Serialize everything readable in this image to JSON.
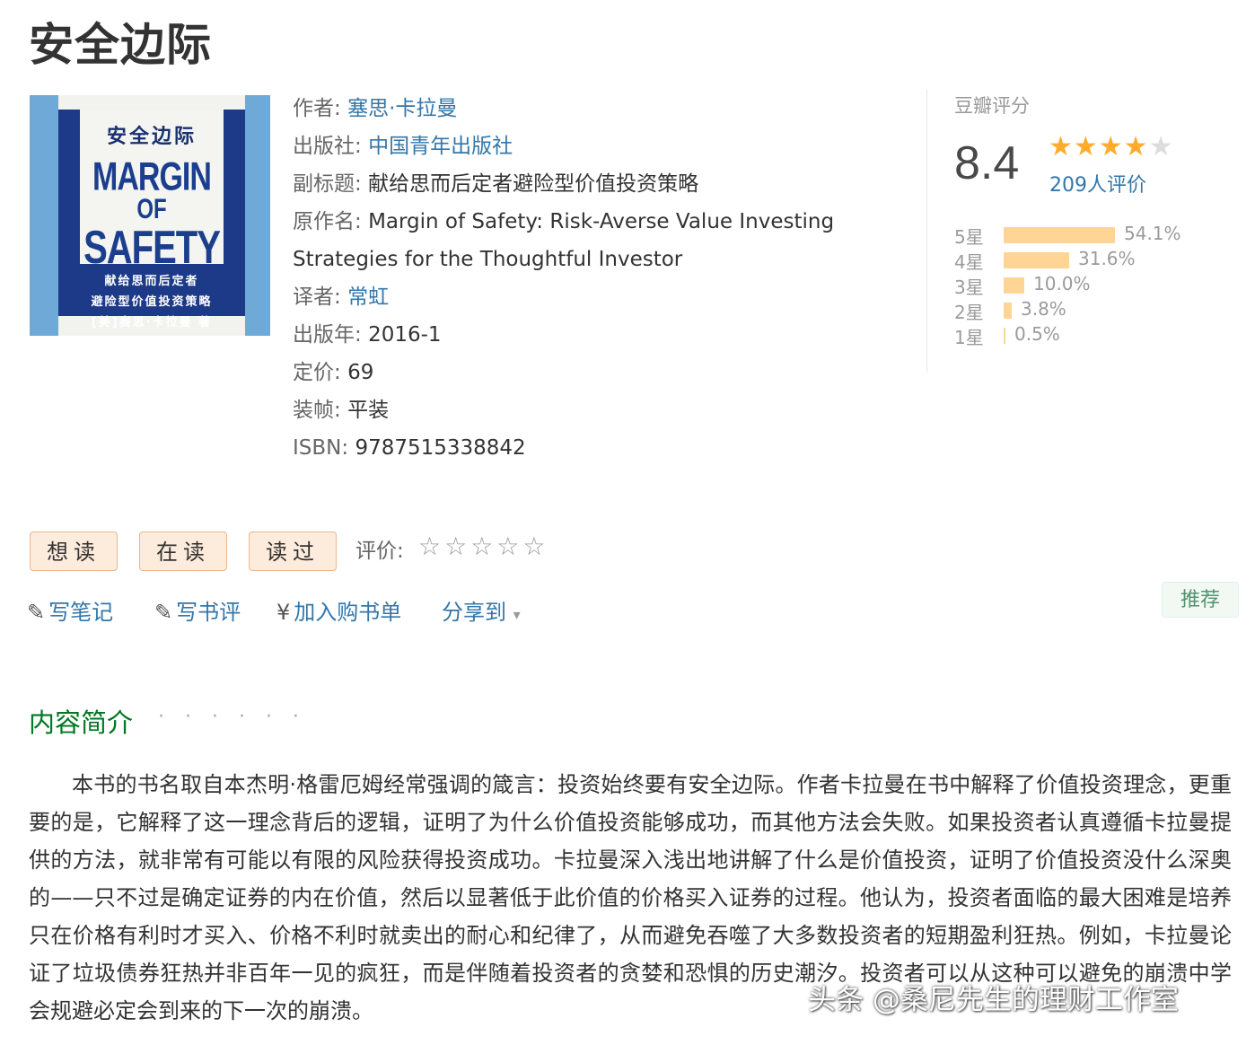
{
  "page_title": "安全边际",
  "cover": {
    "cn_title": "安全边际",
    "en_line1": "MARGIN",
    "en_line2": "OF",
    "en_line3": "SAFETY",
    "sub1": "献给思而后定者",
    "sub2": "避险型价值投资策略",
    "sub3": "[美]赛思·卡拉曼 著"
  },
  "info": {
    "author_label": "作者:",
    "author": "塞思·卡拉曼",
    "publisher_label": "出版社:",
    "publisher": "中国青年出版社",
    "subtitle_label": "副标题:",
    "subtitle": "献给思而后定者避险型价值投资策略",
    "original_title_label": "原作名:",
    "original_title_line1": "Margin of Safety: Risk-Averse Value Investing",
    "original_title_line2": "Strategies for the Thoughtful Investor",
    "translator_label": "译者:",
    "translator": "常虹",
    "pub_year_label": "出版年:",
    "pub_year": "2016-1",
    "price_label": "定价:",
    "price": "69",
    "binding_label": "装帧:",
    "binding": "平装",
    "isbn_label": "ISBN:",
    "isbn": "9787515338842"
  },
  "rating": {
    "header": "豆瓣评分",
    "score": "8.4",
    "stars": "★★★★",
    "stars_empty": "★",
    "count": "209人评价",
    "distribution": [
      {
        "label": "5星",
        "pct_text": "54.1%",
        "value": 54.1
      },
      {
        "label": "4星",
        "pct_text": "31.6%",
        "value": 31.6
      },
      {
        "label": "3星",
        "pct_text": "10.0%",
        "value": 10.0
      },
      {
        "label": "2星",
        "pct_text": "3.8%",
        "value": 3.8
      },
      {
        "label": "1星",
        "pct_text": "0.5%",
        "value": 0.5
      }
    ]
  },
  "actions": {
    "want": "想读",
    "reading": "在读",
    "read": "读过",
    "rate_label": "评价:",
    "rate_stars": "☆☆☆☆☆"
  },
  "tools": {
    "note": "写笔记",
    "review": "写书评",
    "cart": "加入购书单",
    "share": "分享到",
    "recommend": "推荐",
    "icons": {
      "pencil": "✎",
      "yen": "¥",
      "caret": "▾"
    }
  },
  "intro": {
    "title": "内容简介",
    "dots": "· · · · · ·",
    "text": "本书的书名取自本杰明·格雷厄姆经常强调的箴言：投资始终要有安全边际。作者卡拉曼在书中解释了价值投资理念，更重要的是，它解释了这一理念背后的逻辑，证明了为什么价值投资能够成功，而其他方法会失败。如果投资者认真遵循卡拉曼提供的方法，就非常有可能以有限的风险获得投资成功。卡拉曼深入浅出地讲解了什么是价值投资，证明了价值投资没什么深奥的——只不过是确定证券的内在价值，然后以显著低于此价值的价格买入证券的过程。他认为，投资者面临的最大困难是培养只在价格有利时才买入、价格不利时就卖出的耐心和纪律了，从而避免吞噬了大多数投资者的短期盈利狂热。例如，卡拉曼论证了垃圾债券狂热并非百年一见的疯狂，而是伴随着投资者的贪婪和恐惧的历史潮汐。投资者可以从这种可以避免的崩溃中学会规避必定会到来的下一次的崩溃。"
  },
  "watermark": "头条 @桑尼先生的理财工作室",
  "colors": {
    "link": "#3377aa",
    "star": "#ffac2d",
    "bar": "#ffd596",
    "intro_title": "#007722"
  }
}
